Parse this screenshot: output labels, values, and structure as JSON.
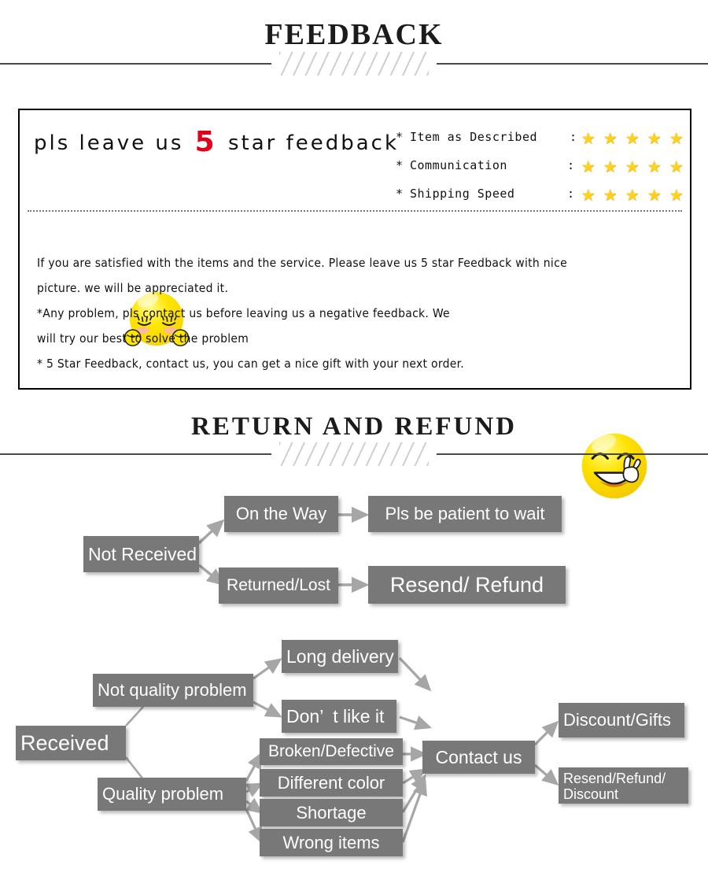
{
  "sections": {
    "feedback": {
      "title": "FEEDBACK"
    },
    "return": {
      "title": "RETURN  AND  REFUND"
    }
  },
  "feedback_panel": {
    "headline_before": "pls leave us ",
    "headline_number": "5",
    "headline_after": " star feedback",
    "ratings": [
      {
        "asterisk": "*",
        "label": "Item as Described",
        "colon": ":",
        "stars": 5
      },
      {
        "asterisk": "*",
        "label": "Communication",
        "colon": ":",
        "stars": 5
      },
      {
        "asterisk": "*",
        "label": "Shipping Speed",
        "colon": ":",
        "stars": 5
      }
    ],
    "star_color": "#ffd21e",
    "number_color": "#e1001a",
    "body_lines": [
      "If you are satisfied with the items and the service. Please leave us 5 star Feedback with nice",
      "picture. we will be appreciated it.",
      "*Any problem, pls contact us before leaving us a negative feedback. We",
      "will try our best to solve  the problem",
      "* 5 Star Feedback, contact us, you can get a nice gift with your next order."
    ],
    "icons": {
      "shy_smiley": "shy-smiley-icon",
      "peace_smiley": "peace-smiley-icon"
    }
  },
  "flowcharts": {
    "node_fill": "#787878",
    "node_text_color": "#ffffff",
    "not_received": {
      "root": "Not Received",
      "branches": [
        {
          "cause": "On the Way",
          "outcome": "Pls be patient to wait"
        },
        {
          "cause": "Returned/Lost",
          "outcome": "Resend/ Refund"
        }
      ]
    },
    "received": {
      "root": "Received",
      "categories": [
        {
          "name": "Not quality problem",
          "reasons": [
            "Long delivery",
            "Don’  t like it"
          ]
        },
        {
          "name": "Quality problem",
          "reasons": [
            "Broken/Defective",
            "Different color",
            "Shortage",
            "Wrong items"
          ]
        }
      ],
      "hub": "Contact us",
      "outcomes": [
        "Discount/Gifts",
        "Resend/Refund/\nDiscount"
      ]
    }
  }
}
